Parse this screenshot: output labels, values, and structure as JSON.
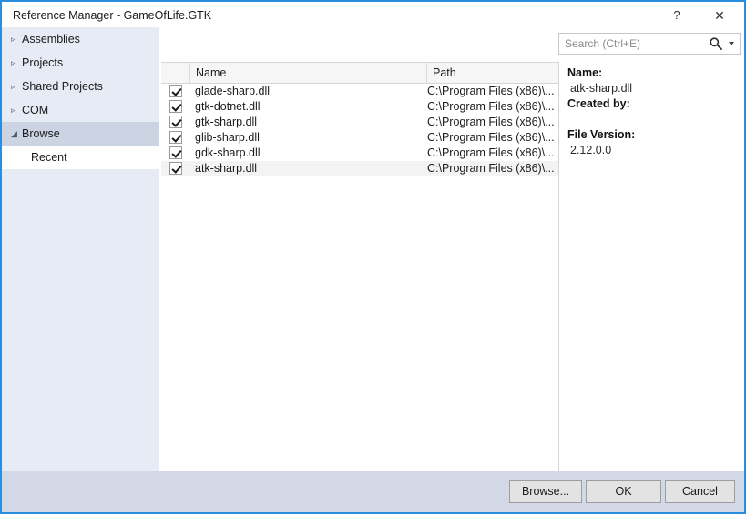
{
  "window": {
    "title": "Reference Manager - GameOfLife.GTK",
    "accent_color": "#2a8ee0",
    "help_icon": "?",
    "close_icon": "✕"
  },
  "sidebar": {
    "items": [
      {
        "label": "Assemblies",
        "marker": "▹",
        "selected": false,
        "sub": false
      },
      {
        "label": "Projects",
        "marker": "▹",
        "selected": false,
        "sub": false
      },
      {
        "label": "Shared Projects",
        "marker": "▹",
        "selected": false,
        "sub": false
      },
      {
        "label": "COM",
        "marker": "▹",
        "selected": false,
        "sub": false
      },
      {
        "label": "Browse",
        "marker": "◢",
        "selected": true,
        "sub": false
      },
      {
        "label": "Recent",
        "marker": "",
        "selected": false,
        "sub": true
      }
    ]
  },
  "search": {
    "placeholder": "Search (Ctrl+E)",
    "value": "",
    "icon": "search-icon",
    "dropdown_icon": "chevron-down-icon"
  },
  "list": {
    "columns": [
      "",
      "Name",
      "Path"
    ],
    "rows": [
      {
        "checked": true,
        "name": "glade-sharp.dll",
        "path": "C:\\Program Files (x86)\\...",
        "selected": false
      },
      {
        "checked": true,
        "name": "gtk-dotnet.dll",
        "path": "C:\\Program Files (x86)\\...",
        "selected": false
      },
      {
        "checked": true,
        "name": "gtk-sharp.dll",
        "path": "C:\\Program Files (x86)\\...",
        "selected": false
      },
      {
        "checked": true,
        "name": "glib-sharp.dll",
        "path": "C:\\Program Files (x86)\\...",
        "selected": false
      },
      {
        "checked": true,
        "name": "gdk-sharp.dll",
        "path": "C:\\Program Files (x86)\\...",
        "selected": false
      },
      {
        "checked": true,
        "name": "atk-sharp.dll",
        "path": "C:\\Program Files (x86)\\...",
        "selected": true
      }
    ]
  },
  "details": {
    "name_label": "Name:",
    "name_value": "atk-sharp.dll",
    "created_by_label": "Created by:",
    "created_by_value": "",
    "file_version_label": "File Version:",
    "file_version_value": "2.12.0.0"
  },
  "buttons": {
    "browse": "Browse...",
    "ok": "OK",
    "cancel": "Cancel"
  }
}
